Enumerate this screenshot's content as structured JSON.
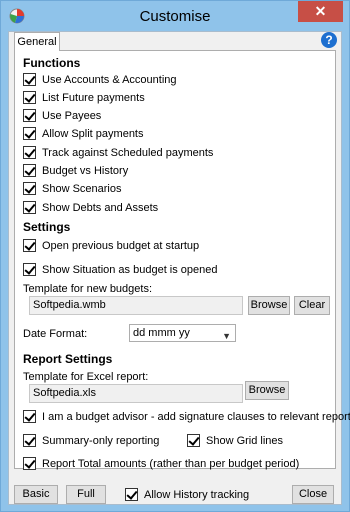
{
  "window": {
    "title": "Customise",
    "close_glyph": "✕"
  },
  "tabs": [
    {
      "label": "General"
    }
  ],
  "help_glyph": "?",
  "functions": {
    "heading": "Functions",
    "items": [
      {
        "label": "Use Accounts & Accounting",
        "checked": true
      },
      {
        "label": "List Future payments",
        "checked": true
      },
      {
        "label": "Use Payees",
        "checked": true
      },
      {
        "label": "Allow Split payments",
        "checked": true
      },
      {
        "label": "Track against Scheduled payments",
        "checked": true
      },
      {
        "label": "Budget vs History",
        "checked": true
      },
      {
        "label": "Show Scenarios",
        "checked": true
      },
      {
        "label": "Show Debts and Assets",
        "checked": true
      }
    ]
  },
  "settings": {
    "heading": "Settings",
    "open_previous": {
      "label": "Open previous budget at startup",
      "checked": true
    },
    "show_situation": {
      "label": "Show Situation as budget is opened",
      "checked": true
    },
    "template_label": "Template for new budgets:",
    "template_value": "Softpedia.wmb",
    "browse_label": "Browse",
    "clear_label": "Clear",
    "date_format_label": "Date Format:",
    "date_format_value": "dd mmm yy"
  },
  "report_settings": {
    "heading": "Report Settings",
    "excel_template_label": "Template for Excel report:",
    "excel_template_value": "Softpedia.xls",
    "browse_label": "Browse",
    "budget_advisor": {
      "label": "I am a budget advisor - add signature clauses to relevant reports",
      "checked": true
    },
    "summary_only": {
      "label": "Summary-only reporting",
      "checked": true
    },
    "show_grid": {
      "label": "Show Grid lines",
      "checked": true
    },
    "report_total": {
      "label": "Report Total amounts (rather than per budget period)",
      "checked": true
    }
  },
  "footer": {
    "basic_label": "Basic",
    "full_label": "Full",
    "allow_history": {
      "label": "Allow History tracking",
      "checked": true
    },
    "close_label": "Close"
  },
  "colors": {
    "titlebar": "#8fc3ea",
    "close": "#c74f46",
    "help": "#1d6fd0"
  }
}
